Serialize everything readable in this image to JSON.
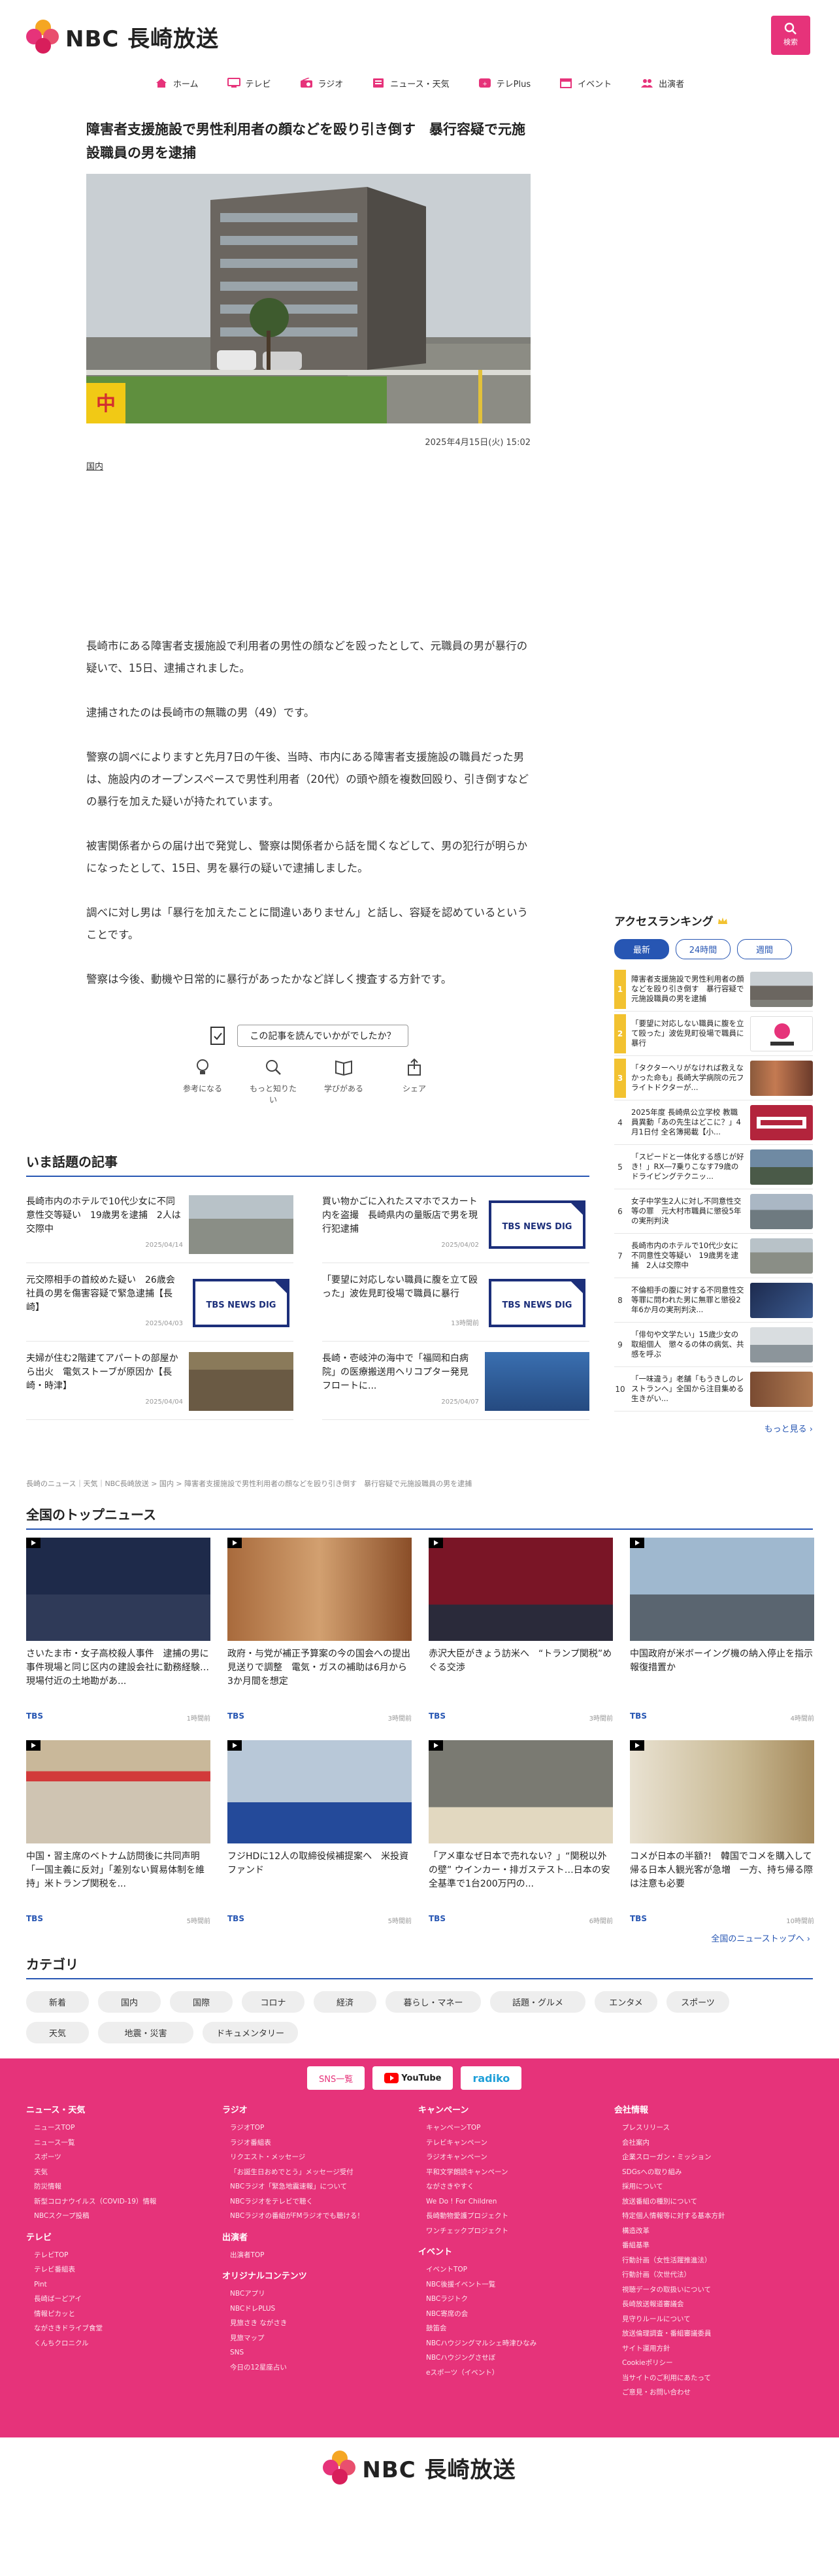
{
  "header": {
    "logo_text": "NBC 長崎放送",
    "search_label": "検索"
  },
  "nav": [
    {
      "label": "ホーム",
      "icon": "home-icon"
    },
    {
      "label": "テレビ",
      "icon": "tv-icon"
    },
    {
      "label": "ラジオ",
      "icon": "radio-icon"
    },
    {
      "label": "ニュース・天気",
      "icon": "news-icon"
    },
    {
      "label": "テレPlus",
      "icon": "teleplus-icon"
    },
    {
      "label": "イベント",
      "icon": "calendar-icon"
    },
    {
      "label": "出演者",
      "icon": "people-icon"
    }
  ],
  "article": {
    "title": "障害者支援施設で男性利用者の顔などを殴り引き倒す　暴行容疑で元施設職員の男を逮捕",
    "date": "2025年4月15日(火) 15:02",
    "category": "国内",
    "paragraphs": [
      "長崎市にある障害者支援施設で利用者の男性の顔などを殴ったとして、元職員の男が暴行の疑いで、15日、逮捕されました。",
      "逮捕されたのは長崎市の無職の男（49）です。",
      "警察の調べによりますと先月7日の午後、当時、市内にある障害者支援施設の職員だった男は、施設内のオープンスペースで男性利用者（20代）の頭や顔を複数回殴り、引き倒すなどの暴行を加えた疑いが持たれています。",
      "被害関係者からの届け出で発覚し、警察は関係者から話を聞くなどして、男の犯行が明らかになったとして、15日、男を暴行の疑いで逮捕しました。",
      "調べに対し男は「暴行を加えたことに間違いありません」と話し、容疑を認めているということです。",
      "警察は今後、動機や日常的に暴行があったかなど詳しく捜査する方針です。"
    ]
  },
  "feedback": {
    "question": "この記事を読んでいかがでしたか？",
    "reactions": [
      {
        "label": "参考になる",
        "icon": "lightbulb-icon"
      },
      {
        "label": "もっと知りたい",
        "icon": "magnifier-icon"
      },
      {
        "label": "学びがある",
        "icon": "book-icon"
      },
      {
        "label": "シェア",
        "icon": "share-icon"
      }
    ]
  },
  "ranking": {
    "title": "アクセスランキング",
    "tabs": [
      "最新",
      "24時間",
      "週間"
    ],
    "items": [
      {
        "rank": "1",
        "text": "障害者支援施設で男性利用者の顔などを殴り引き倒す　暴行容疑で元施設職員の男を逮捕"
      },
      {
        "rank": "2",
        "text": "「要望に対応しない職員に腹を立て殴った」波佐見町役場で職員に暴行"
      },
      {
        "rank": "3",
        "text": "「タクターヘリがなければ救えなかった命も」長崎大学病院の元フライトドクターが..."
      },
      {
        "rank": "4",
        "text": "2025年度 長崎県公立学校 教職員異動「あの先生はどこに？」4月1日付 全名簿掲載【小..."
      },
      {
        "rank": "5",
        "text": "「スピードと一体化する感じが好き！」RX―7乗りこなす79歳のドライビングテクニッ..."
      },
      {
        "rank": "6",
        "text": "女子中学生2人に対し不同意性交等の罪　元大村市職員に懲役5年の実刑判決"
      },
      {
        "rank": "7",
        "text": "長崎市内のホテルで10代少女に不同意性交等疑い　19歳男を逮捕　2人は交際中"
      },
      {
        "rank": "8",
        "text": "不倫相手の腹に対する不同意性交等罪に問われた男に無罪と懲役2年6か月の実刑判決..."
      },
      {
        "rank": "9",
        "text": "「俳句や文学たい」15歳少女の取組個人　懲々るの体の病気、共感を呼ぶ"
      },
      {
        "rank": "10",
        "text": "「一味違う」老舗「もうきしのレストランへ」全国から注目集める生きがい..."
      }
    ],
    "more": "もっと見る ›"
  },
  "hot": {
    "title": "いま話題の記事",
    "items": [
      {
        "text": "長崎市内のホテルで10代少女に不同意性交等疑い　19歳男を逮捕　2人は交際中",
        "date": "2025/04/14"
      },
      {
        "text": "買い物かごに入れたスマホでスカート内を盗撮　長崎県内の量販店で男を現行犯逮捕",
        "date": "2025/04/02"
      },
      {
        "text": "元交際相手の首絞めた疑い　26歳会社員の男を傷害容疑で緊急逮捕【長崎】",
        "date": "2025/04/03"
      },
      {
        "text": "「要望に対応しない職員に腹を立て殴った」波佐見町役場で職員に暴行",
        "date": "13時間前"
      },
      {
        "text": "夫婦が住む2階建てアパートの部屋から出火　電気ストーブが原因か【長崎・時津】",
        "date": "2025/04/04"
      },
      {
        "text": "長崎・壱岐沖の海中で「福岡和白病院」の医療搬送用ヘリコプター発見　フロートに...",
        "date": "2025/04/07"
      }
    ],
    "tbs_label": "TBS NEWS DIG"
  },
  "breadcrumb": "長崎のニュース｜天気｜NBC長崎放送 > 国内 > 障害者支援施設で男性利用者の顔などを殴り引き倒す　暴行容疑で元施設職員の男を逮捕",
  "topnews": {
    "title": "全国のトップニュース",
    "items": [
      {
        "title": "さいたま市・女子高校殺人事件　逮捕の男に事件現場と同じ区内の建設会社に勤務経験…現場付近の土地勘があ...",
        "source": "TBS",
        "ago": "1時間前"
      },
      {
        "title": "政府・与党が補正予算案の今の国会への提出見送りで調整　電気・ガスの補助は6月から3か月間を想定",
        "source": "TBS",
        "ago": "3時間前"
      },
      {
        "title": "赤沢大臣がきょう訪米へ　“トランプ関税”めぐる交渉",
        "source": "TBS",
        "ago": "3時間前"
      },
      {
        "title": "中国政府が米ボーイング機の納入停止を指示　報復措置か",
        "source": "TBS",
        "ago": "4時間前"
      },
      {
        "title": "中国・習主席のベトナム訪問後に共同声明「一国主義に反対」「差別ない貿易体制を維持」米トランプ関税を...",
        "source": "TBS",
        "ago": "5時間前"
      },
      {
        "title": "フジHDに12人の取締役候補提案へ　米投資ファンド",
        "source": "TBS",
        "ago": "5時間前"
      },
      {
        "title": "「アメ車なぜ日本で売れない？」“関税以外の壁” ウインカー・排ガステスト…日本の安全基準で1台200万円の...",
        "source": "TBS",
        "ago": "6時間前"
      },
      {
        "title": "コメが日本の半額?!　韓国でコメを購入して帰る日本人観光客が急増　一方、持ち帰る際は注意も必要",
        "source": "TBS",
        "ago": "10時間前"
      }
    ],
    "all_link": "全国のニューストップへ ›"
  },
  "categories": {
    "title": "カテゴリ",
    "items": [
      "新着",
      "国内",
      "国際",
      "コロナ",
      "経済",
      "暮らし・マネー",
      "話題・グルメ",
      "エンタメ",
      "スポーツ",
      "天気",
      "地震・災害",
      "ドキュメンタリー"
    ]
  },
  "footer": {
    "sns": [
      "SNS一覧",
      "YouTube",
      "radiko"
    ],
    "columns": [
      {
        "groups": [
          {
            "title": "ニュース・天気",
            "links": [
              "ニュースTOP",
              "ニュース一覧",
              "スポーツ",
              "天気",
              "防災情報",
              "新型コロナウイルス（COVID-19）情報",
              "NBCスクープ投稿"
            ]
          },
          {
            "title": "テレビ",
            "links": [
              "テレビTOP",
              "テレビ番組表",
              "Pint",
              "長崎ばーどアイ",
              "情報ピカッと",
              "ながさきドライブ食堂",
              "くんちクロニクル"
            ]
          }
        ]
      },
      {
        "groups": [
          {
            "title": "ラジオ",
            "links": [
              "ラジオTOP",
              "ラジオ番組表",
              "リクエスト・メッセージ",
              "「お誕生日おめでとう」メッセージ受付",
              "NBCラジオ「緊急地震速報」について",
              "NBCラジオをテレビで聴く",
              "NBCラジオの番組がFMラジオでも聴ける！"
            ]
          },
          {
            "title": "出演者",
            "links": [
              "出演者TOP"
            ]
          },
          {
            "title": "オリジナルコンテンツ",
            "links": [
              "NBCアプリ",
              "NBCドレPLUS",
              "見旅さき ながさき",
              "見旅マップ",
              "SNS",
              "今日の12星座占い"
            ]
          }
        ]
      },
      {
        "groups": [
          {
            "title": "キャンペーン",
            "links": [
              "キャンペーンTOP",
              "テレビキャンペーン",
              "ラジオキャンペーン",
              "平和文学朗読キャンペーン",
              "ながさきやすく",
              "We Do ! For Children",
              "長崎動物愛護プロジェクト",
              "ワンチェックプロジェクト"
            ]
          },
          {
            "title": "イベント",
            "links": [
              "イベントTOP",
              "NBC後援イベント一覧",
              "NBCラジトク",
              "NBC寄席の会",
              "鼓笛会",
              "NBCハウジングマルシェ時津ひなみ",
              "NBCハウジングさせぼ",
              "eスポーツ（イベント）"
            ]
          }
        ]
      },
      {
        "groups": [
          {
            "title": "会社情報",
            "links": [
              "プレスリリース",
              "会社案内",
              "企業スローガン・ミッション",
              "SDGsへの取り組み",
              "採用について",
              "放送番組の種別について",
              "特定個人情報等に対する基本方針",
              "構造改革",
              "番組基準",
              "行動計画（女性活躍推進法）",
              "行動計画（次世代法）",
              "視聴データの取扱いについて",
              "長崎放送報道審議会",
              "見守りルールについて",
              "放送倫理調査・番組審議委員",
              "サイト運用方針",
              "Cookieポリシー",
              "当サイトのご利用にあたって",
              "ご意見・お問い合わせ"
            ]
          }
        ]
      }
    ]
  },
  "colors": {
    "brand_pink": "#e6337a",
    "link_blue": "#2756b3",
    "rank_gold": "#f2c230"
  }
}
